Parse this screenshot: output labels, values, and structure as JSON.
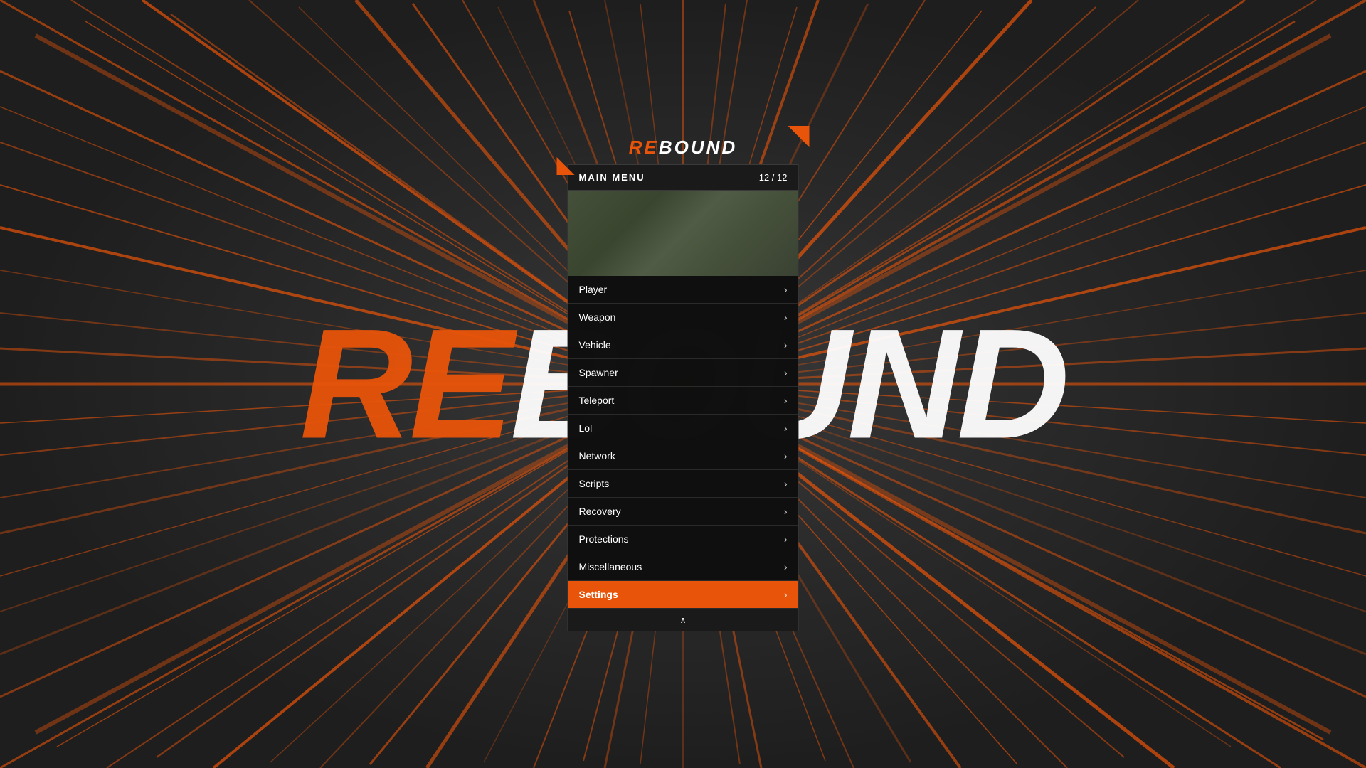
{
  "background": {
    "color": "#2d2d2d",
    "accent_color": "#e8540a"
  },
  "logo": {
    "re": "RE",
    "bound": "BOUND"
  },
  "watermark": {
    "re": "RE",
    "bound": "BOUND"
  },
  "menu": {
    "title": "MAIN MENU",
    "counter": "12 / 12",
    "items": [
      {
        "label": "Player",
        "arrow": "›",
        "active": false
      },
      {
        "label": "Weapon",
        "arrow": "›",
        "active": false
      },
      {
        "label": "Vehicle",
        "arrow": "›",
        "active": false
      },
      {
        "label": "Spawner",
        "arrow": "›",
        "active": false
      },
      {
        "label": "Teleport",
        "arrow": "›",
        "active": false
      },
      {
        "label": "Lol",
        "arrow": "›",
        "active": false
      },
      {
        "label": "Network",
        "arrow": "›",
        "active": false
      },
      {
        "label": "Scripts",
        "arrow": "›",
        "active": false
      },
      {
        "label": "Recovery",
        "arrow": "›",
        "active": false
      },
      {
        "label": "Protections",
        "arrow": "›",
        "active": false
      },
      {
        "label": "Miscellaneous",
        "arrow": "›",
        "active": false
      },
      {
        "label": "Settings",
        "arrow": "›",
        "active": true
      }
    ],
    "footer_arrow": "∧"
  }
}
